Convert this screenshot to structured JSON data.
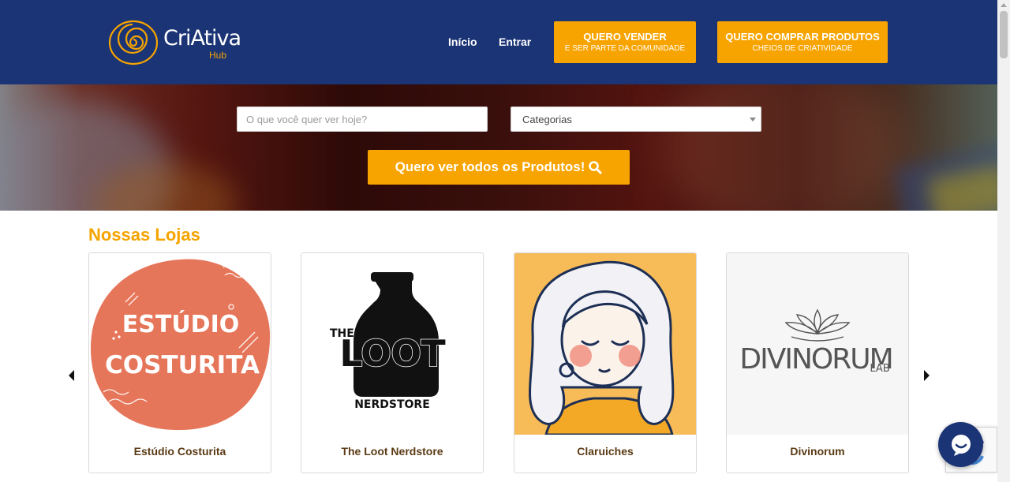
{
  "brand": {
    "name": "CriAtiva",
    "sub": "Hub",
    "colors": {
      "navy": "#1b3475",
      "orange": "#f8a400",
      "brown_text": "#5b3a14"
    }
  },
  "nav": {
    "inicio": "Início",
    "entrar": "Entrar",
    "sell_title": "QUERO VENDER",
    "sell_sub": "E SER PARTE DA COMUNIDADE",
    "buy_title": "QUERO  COMPRAR PRODUTOS",
    "buy_sub": "CHEIOS DE CRIATIVIDADE"
  },
  "search": {
    "placeholder": "O que você quer ver hoje?",
    "category_selected": "Categorias",
    "button_label": "Quero ver todos os Produtos!",
    "button_icon": "search-icon"
  },
  "stores": {
    "title": "Nossas Lojas",
    "items": [
      {
        "name": "Estúdio Costurita",
        "logo_line1": "ESTÚDIO",
        "logo_line2": "COSTURITA"
      },
      {
        "name": "The Loot Nerdstore",
        "logo_the": "THE",
        "logo_main": "LOOT",
        "logo_sub": "NERDSTORE"
      },
      {
        "name": "Claruiches"
      },
      {
        "name": "Divinorum",
        "logo_main": "DIVINORUM",
        "logo_sub": "LAB"
      }
    ]
  }
}
